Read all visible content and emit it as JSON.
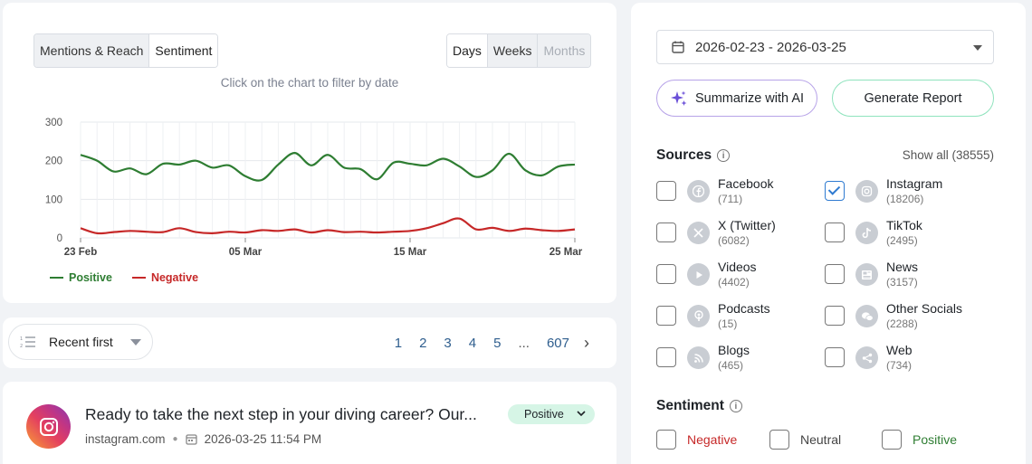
{
  "chart_controls": {
    "metric_tabs": [
      "Mentions & Reach",
      "Sentiment"
    ],
    "metric_active": "Sentiment",
    "period_tabs": [
      "Days",
      "Weeks",
      "Months"
    ],
    "period_active": "Days",
    "period_disabled": "Months",
    "hint": "Click on the chart to filter by date"
  },
  "chart_data": {
    "type": "line",
    "x": [
      "2026-02-23",
      "2026-02-24",
      "2026-02-25",
      "2026-02-26",
      "2026-02-27",
      "2026-02-28",
      "2026-03-01",
      "2026-03-02",
      "2026-03-03",
      "2026-03-04",
      "2026-03-05",
      "2026-03-06",
      "2026-03-07",
      "2026-03-08",
      "2026-03-09",
      "2026-03-10",
      "2026-03-11",
      "2026-03-12",
      "2026-03-13",
      "2026-03-14",
      "2026-03-15",
      "2026-03-16",
      "2026-03-17",
      "2026-03-18",
      "2026-03-19",
      "2026-03-20",
      "2026-03-21",
      "2026-03-22",
      "2026-03-23",
      "2026-03-24",
      "2026-03-25"
    ],
    "x_ticks": [
      "23 Feb",
      "05 Mar",
      "15 Mar",
      "25 Mar"
    ],
    "y_ticks": [
      0,
      100,
      200,
      300
    ],
    "ylim": [
      0,
      300
    ],
    "grid": true,
    "legend": "bottom-left",
    "series": [
      {
        "name": "Positive",
        "color": "#2e7d32",
        "values": [
          215,
          200,
          172,
          180,
          165,
          192,
          190,
          200,
          182,
          188,
          160,
          150,
          190,
          220,
          188,
          215,
          182,
          178,
          152,
          195,
          192,
          188,
          205,
          185,
          158,
          175,
          218,
          175,
          162,
          185,
          190
        ]
      },
      {
        "name": "Negative",
        "color": "#c62828",
        "values": [
          25,
          12,
          15,
          18,
          16,
          15,
          25,
          15,
          12,
          16,
          14,
          20,
          18,
          22,
          14,
          20,
          15,
          16,
          14,
          16,
          18,
          25,
          38,
          50,
          22,
          26,
          18,
          24,
          20,
          18,
          22
        ]
      }
    ]
  },
  "list_controls": {
    "sort_label": "Recent first",
    "pages": [
      "1",
      "2",
      "3",
      "4",
      "5",
      "...",
      "607"
    ],
    "next_label": "›"
  },
  "post": {
    "title": "Ready to take the next step in your diving career? Our...",
    "source": "instagram.com",
    "datetime": "2026-03-25 11:54 PM",
    "sentiment": "Positive"
  },
  "filters": {
    "date_range": "2026-02-23 - 2026-03-25",
    "summarize_label": "Summarize with AI",
    "report_label": "Generate Report",
    "sources_title": "Sources",
    "show_all": "Show all (38555)",
    "sources": [
      {
        "name": "Facebook",
        "count": "(711)",
        "checked": false,
        "icon": "facebook-icon"
      },
      {
        "name": "Instagram",
        "count": "(18206)",
        "checked": true,
        "icon": "instagram-icon"
      },
      {
        "name": "X (Twitter)",
        "count": "(6082)",
        "checked": false,
        "icon": "x-icon"
      },
      {
        "name": "TikTok",
        "count": "(2495)",
        "checked": false,
        "icon": "tiktok-icon"
      },
      {
        "name": "Videos",
        "count": "(4402)",
        "checked": false,
        "icon": "play-icon"
      },
      {
        "name": "News",
        "count": "(3157)",
        "checked": false,
        "icon": "news-icon"
      },
      {
        "name": "Podcasts",
        "count": "(15)",
        "checked": false,
        "icon": "podcast-icon"
      },
      {
        "name": "Other Socials",
        "count": "(2288)",
        "checked": false,
        "icon": "chat-icon"
      },
      {
        "name": "Blogs",
        "count": "(465)",
        "checked": false,
        "icon": "rss-icon"
      },
      {
        "name": "Web",
        "count": "(734)",
        "checked": false,
        "icon": "share-icon"
      }
    ],
    "sentiment_title": "Sentiment",
    "sentiments": [
      {
        "label": "Negative",
        "color": "#c62828"
      },
      {
        "label": "Neutral",
        "color": "#444444"
      },
      {
        "label": "Positive",
        "color": "#2e7d32"
      }
    ]
  }
}
